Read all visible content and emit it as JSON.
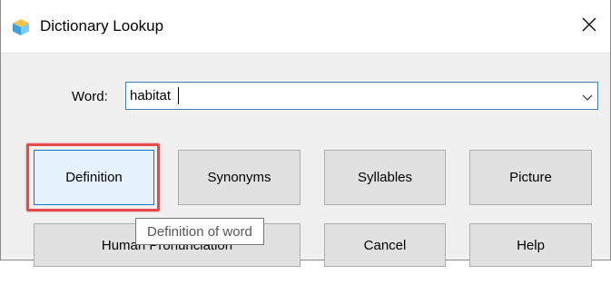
{
  "window": {
    "title": "Dictionary Lookup",
    "icon": "dictionary-app-icon",
    "close_icon": "close-icon"
  },
  "word_field": {
    "label": "Word:",
    "value": "habitat",
    "dropdown_icon": "chevron-down-icon"
  },
  "buttons": {
    "definition": "Definition",
    "synonyms": "Synonyms",
    "syllables": "Syllables",
    "picture": "Picture",
    "human_pronunciation": "Human Pronunciation",
    "cancel": "Cancel",
    "help": "Help"
  },
  "tooltip": {
    "text": "Definition of word"
  },
  "colors": {
    "highlight": "#e5484d",
    "focus_border": "#0078d7",
    "dialog_bg": "#f0f0f0"
  }
}
